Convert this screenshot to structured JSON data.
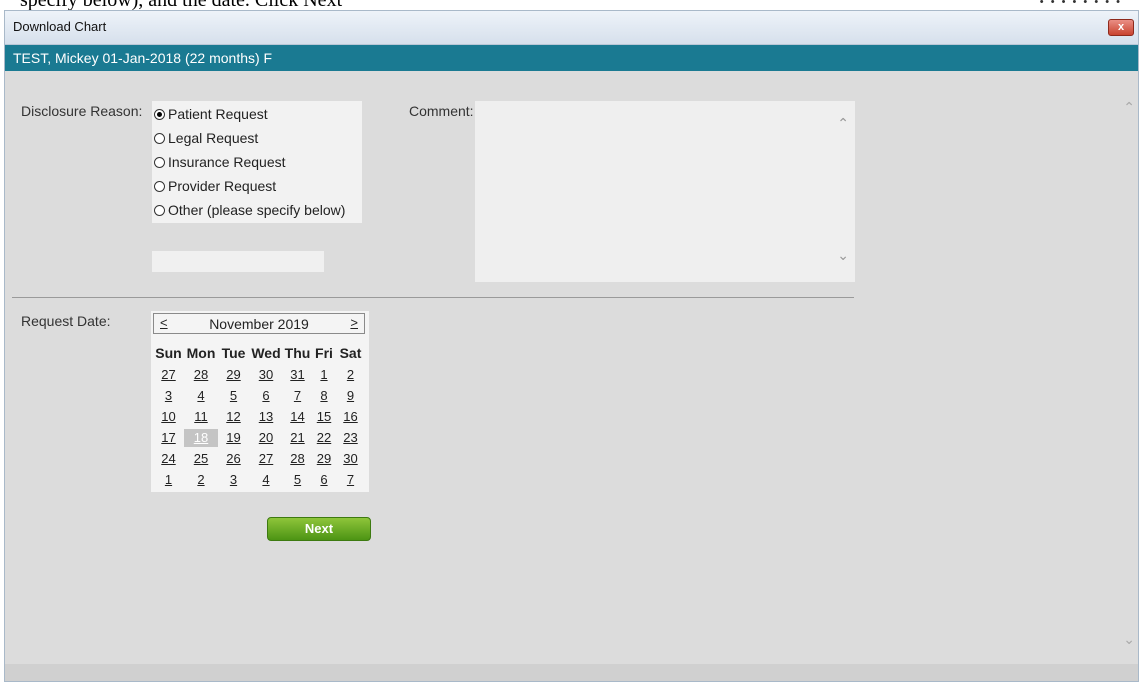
{
  "background": {
    "fragment_left": "specify below), and the date. Click Next",
    "fragment_right": "• • • • • • • •"
  },
  "window": {
    "title": "Download Chart",
    "close_glyph": "x",
    "patient_header": "TEST, Mickey  01-Jan-2018  (22 months)  F"
  },
  "form": {
    "disclosure_label": "Disclosure Reason:",
    "reasons": [
      {
        "label": "Patient Request",
        "checked": true
      },
      {
        "label": "Legal Request",
        "checked": false
      },
      {
        "label": "Insurance Request",
        "checked": false
      },
      {
        "label": "Provider Request",
        "checked": false
      },
      {
        "label": "Other (please specify below)",
        "checked": false
      }
    ],
    "other_value": "",
    "comment_label": "Comment:",
    "comment_value": "",
    "request_date_label": "Request Date:",
    "next_label": "Next"
  },
  "calendar": {
    "prev": "<",
    "month": "November 2019",
    "next": ">",
    "days_of_week": [
      "Sun",
      "Mon",
      "Tue",
      "Wed",
      "Thu",
      "Fri",
      "Sat"
    ],
    "weeks": [
      [
        "27",
        "28",
        "29",
        "30",
        "31",
        "1",
        "2"
      ],
      [
        "3",
        "4",
        "5",
        "6",
        "7",
        "8",
        "9"
      ],
      [
        "10",
        "11",
        "12",
        "13",
        "14",
        "15",
        "16"
      ],
      [
        "17",
        "18",
        "19",
        "20",
        "21",
        "22",
        "23"
      ],
      [
        "24",
        "25",
        "26",
        "27",
        "28",
        "29",
        "30"
      ],
      [
        "1",
        "2",
        "3",
        "4",
        "5",
        "6",
        "7"
      ]
    ],
    "selected_day": "18"
  },
  "icons": {
    "scroll_up": "chevron-up-icon",
    "scroll_down": "chevron-down-icon",
    "close": "close-icon"
  },
  "colors": {
    "patient_bar": "#1a7a92",
    "next_button": "#5fa51f",
    "close_button": "#c9442f"
  }
}
